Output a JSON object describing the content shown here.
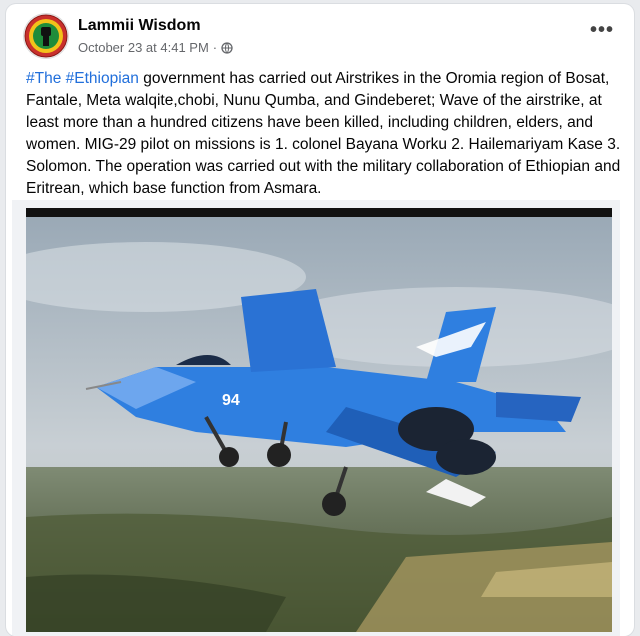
{
  "post": {
    "author": "Lammii Wisdom",
    "timestamp": "October 23 at 4:41 PM",
    "separator": "·",
    "privacy_icon": "globe-icon",
    "more_icon": "more-options-icon",
    "more_label": "•••",
    "hashtags": [
      "#The",
      "#Ethiopian"
    ],
    "body": "government has carried out Airstrikes in the Oromia region of Bosat, Fantale, Meta walqite,chobi, Nunu Qumba, and Gindeberet; Wave of the airstrike, at least more than a hundred citizens have been killed, including children, elders, and women. MIG-29 pilot on missions is 1. colonel Bayana Worku 2. Hailemariyam Kase 3. Solomon. The operation was carried out with the military collaboration of Ethiopian and Eritrean, which base function from Asmara."
  },
  "photo": {
    "tail_number": "94",
    "colors": {
      "sky": "#b8c3cc",
      "jet_blue": "#2f7fe0",
      "ground": "#5d6b4a"
    }
  },
  "colors": {
    "link": "#216fdb",
    "secondary_text": "#65676b"
  }
}
